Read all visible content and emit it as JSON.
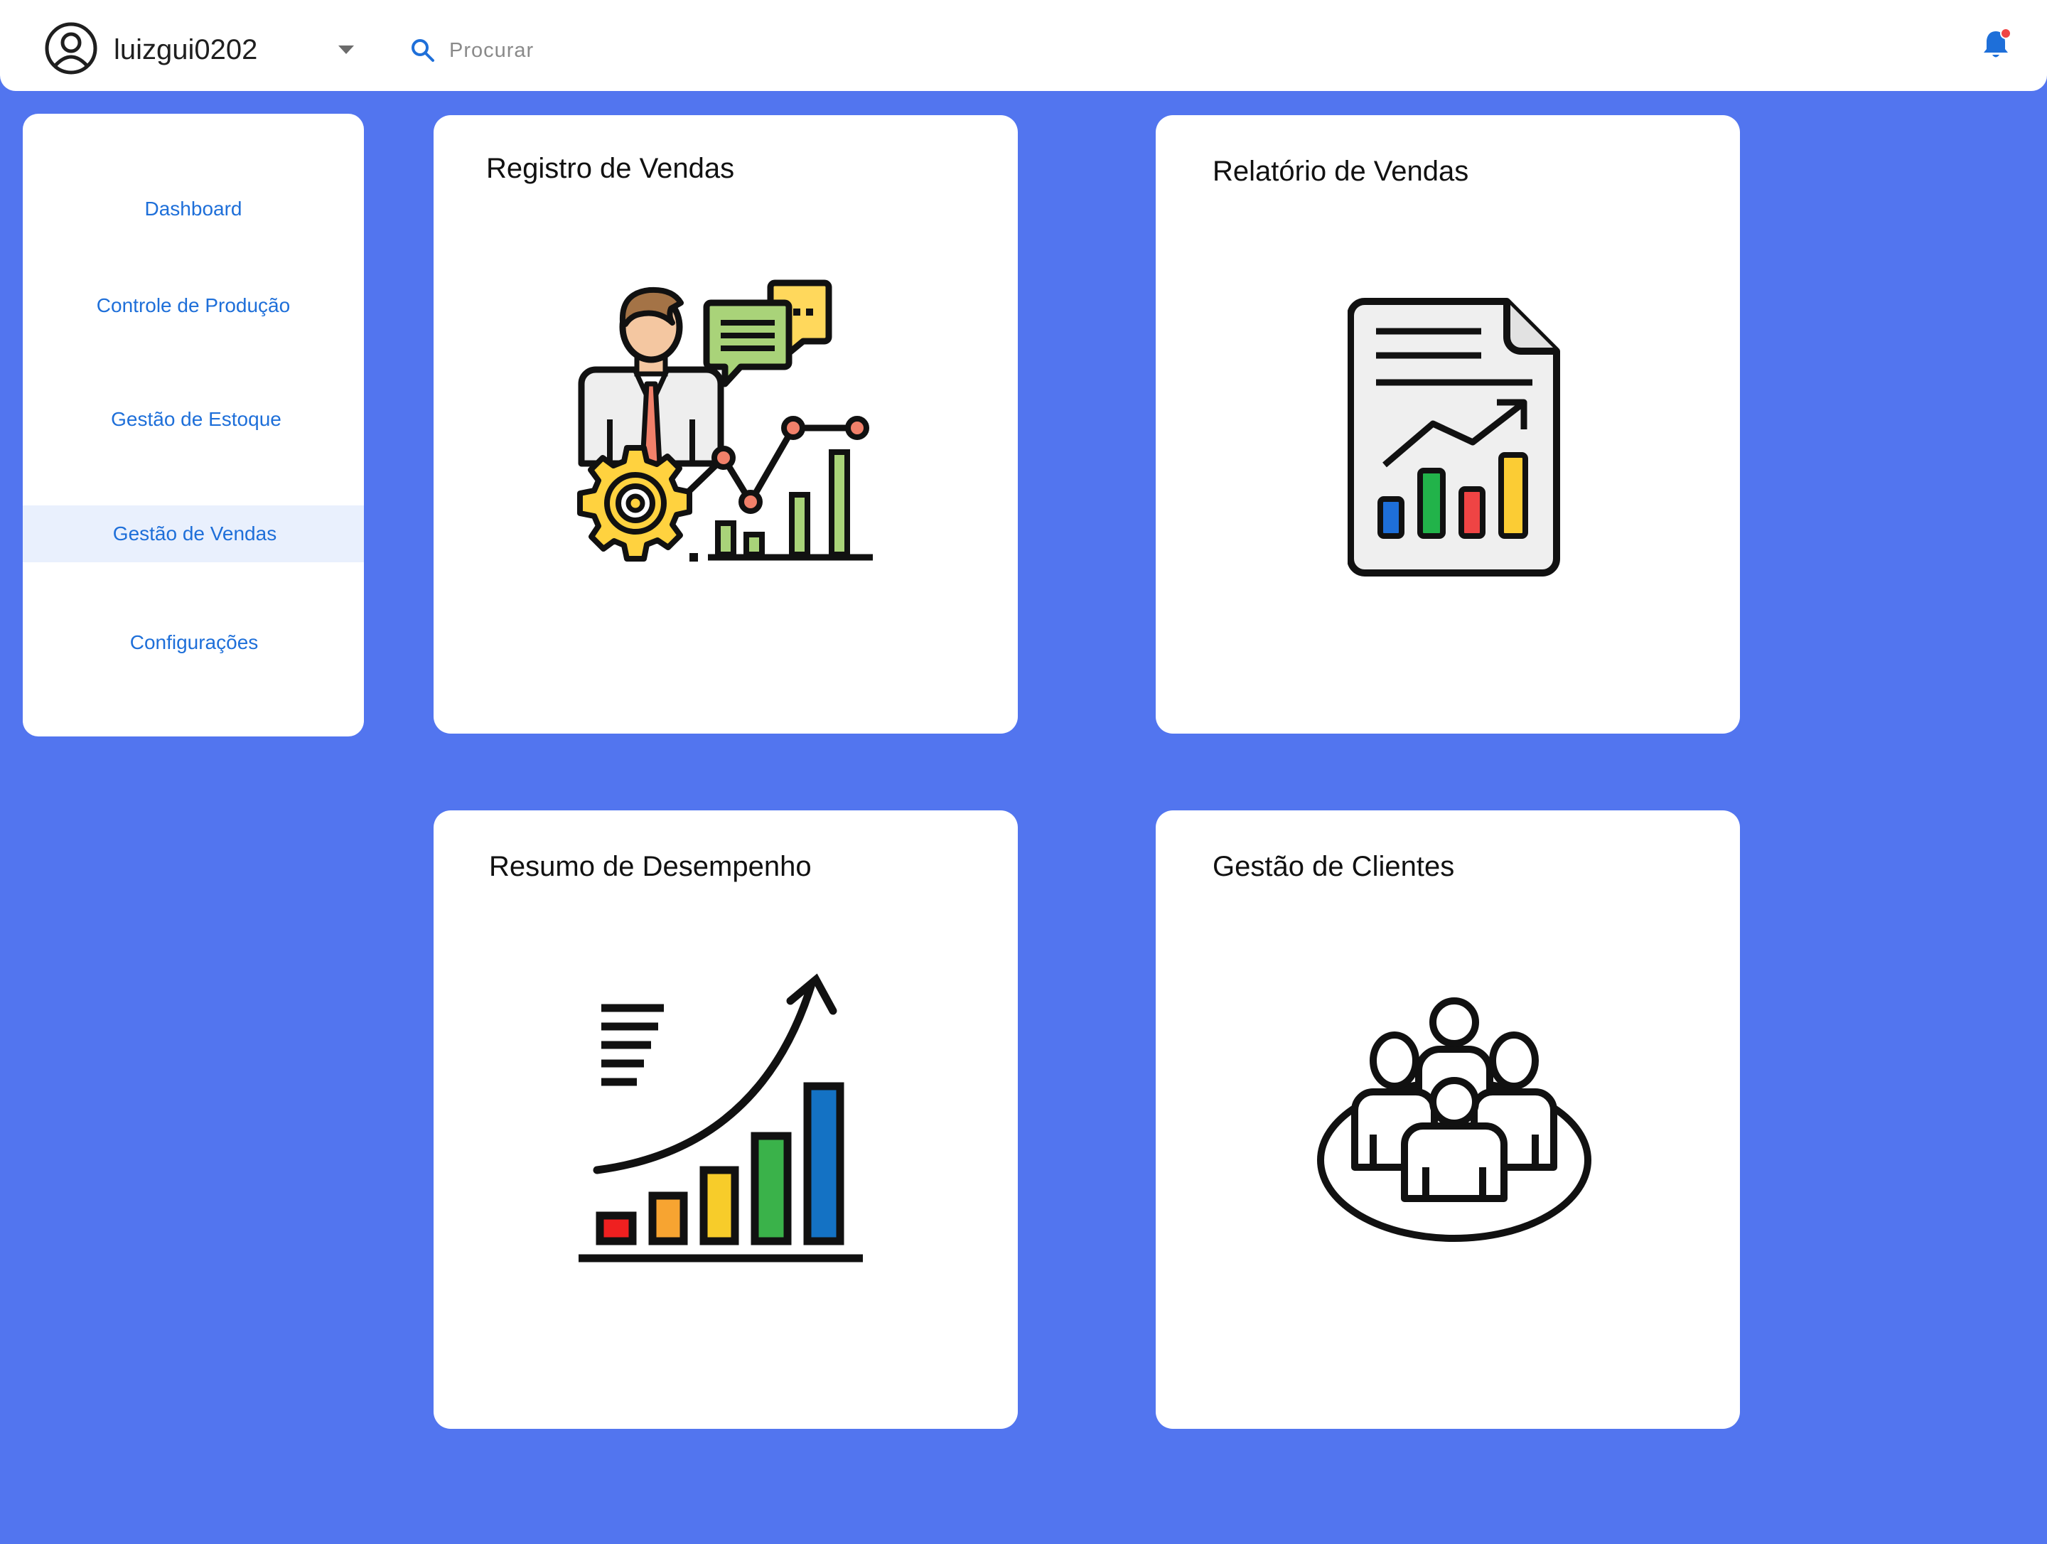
{
  "header": {
    "username": "luizgui0202",
    "search_placeholder": "Procurar",
    "notification_color": "#ef4444",
    "accent": "#1e6fd9"
  },
  "sidebar": {
    "items": [
      {
        "label": "Dashboard",
        "active": false
      },
      {
        "label": "Controle de Produção",
        "active": false
      },
      {
        "label": "Gestão de Estoque",
        "active": false
      },
      {
        "label": "Gestão de Vendas",
        "active": true
      },
      {
        "label": "Configurações",
        "active": false
      }
    ]
  },
  "cards": [
    {
      "title": "Registro de Vendas",
      "icon": "sales-registration-illustration"
    },
    {
      "title": "Relatório de Vendas",
      "icon": "sales-report-document-icon"
    },
    {
      "title": "Resumo de Desempenho",
      "icon": "performance-growth-chart-icon"
    },
    {
      "title": "Gestão de Clientes",
      "icon": "customer-group-icon"
    }
  ],
  "theme": {
    "background": "#5275ef",
    "surface": "#ffffff",
    "active_nav_bg": "#e9f0fd"
  }
}
